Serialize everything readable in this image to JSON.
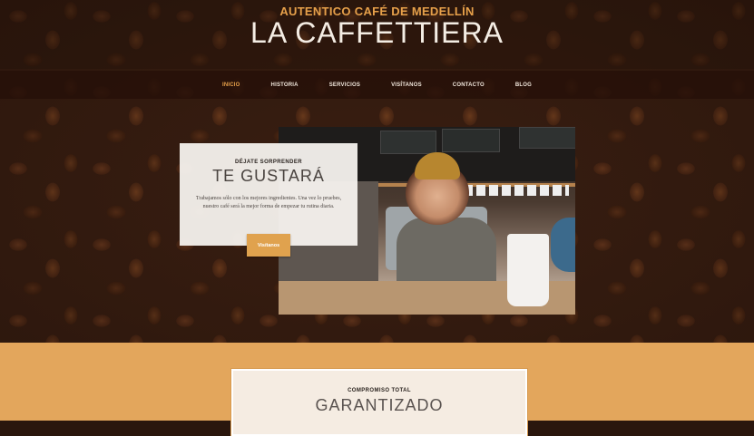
{
  "header": {
    "tagline": "AUTENTICO CAFÉ DE MEDELLÍN",
    "brand": "LA CAFFETTIERA"
  },
  "nav": {
    "items": [
      {
        "label": "INICIO",
        "active": true
      },
      {
        "label": "HISTORIA",
        "active": false
      },
      {
        "label": "SERVICIOS",
        "active": false
      },
      {
        "label": "VISÍTANOS",
        "active": false
      },
      {
        "label": "CONTACTO",
        "active": false
      },
      {
        "label": "BLOG",
        "active": false
      }
    ]
  },
  "hero": {
    "eyebrow": "DÉJATE SORPRENDER",
    "headline": "TE GUSTARÁ",
    "body": "Trabajamos sólo con los mejores ingredientes. Una vez lo pruebes, nuestro café será la mejor forma de empezar tu rutina diaria.",
    "button_label": "Visítanos"
  },
  "promise": {
    "eyebrow": "COMPROMISO TOTAL",
    "headline": "GARANTIZADO"
  },
  "colors": {
    "accent": "#e6a04a",
    "nav_bg": "#26100a",
    "lower_bg": "#e3a65c"
  }
}
